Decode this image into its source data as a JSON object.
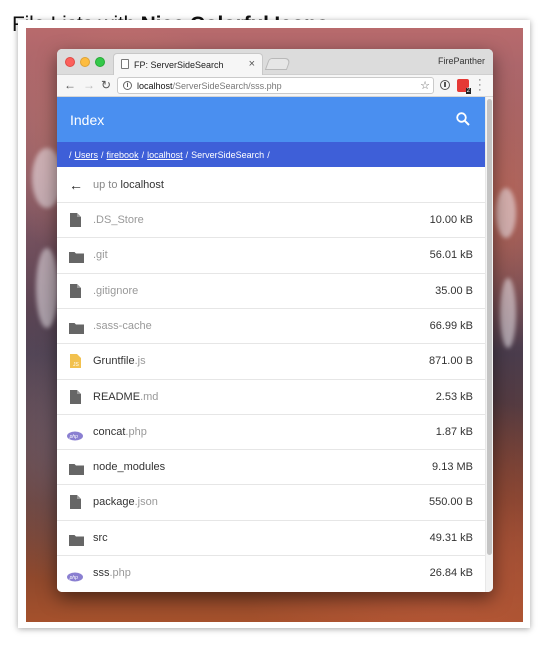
{
  "headline": {
    "part1": "File Lists with ",
    "part2": "Nice Colorful Icons"
  },
  "browser": {
    "tab_title": "FP: ServerSideSearch",
    "tab_close": "×",
    "profile": "FirePanther",
    "url_host": "localhost",
    "url_path": "/ServerSideSearch/sss.php",
    "extension_badge": "2"
  },
  "app": {
    "title": "Index"
  },
  "breadcrumb": {
    "items": [
      {
        "label": "Users",
        "link": true
      },
      {
        "label": "firebook",
        "link": true
      },
      {
        "label": "localhost",
        "link": true
      },
      {
        "label": "ServerSideSearch",
        "link": false
      }
    ]
  },
  "up": {
    "prefix": "up to ",
    "target": "localhost"
  },
  "files": [
    {
      "base": "",
      "ext": ".DS_Store",
      "size": "10.00 kB",
      "icon": "file-icon"
    },
    {
      "base": "",
      "ext": ".git",
      "size": "56.01 kB",
      "icon": "folder-icon"
    },
    {
      "base": "",
      "ext": ".gitignore",
      "size": "35.00 B",
      "icon": "file-icon"
    },
    {
      "base": "",
      "ext": ".sass-cache",
      "size": "66.99 kB",
      "icon": "folder-icon"
    },
    {
      "base": "Gruntfile",
      "ext": ".js",
      "size": "871.00 B",
      "icon": "js-icon"
    },
    {
      "base": "README",
      "ext": ".md",
      "size": "2.53 kB",
      "icon": "file-icon"
    },
    {
      "base": "concat",
      "ext": ".php",
      "size": "1.87 kB",
      "icon": "php-icon"
    },
    {
      "base": "node_modules",
      "ext": "",
      "size": "9.13 MB",
      "icon": "folder-icon"
    },
    {
      "base": "package",
      "ext": ".json",
      "size": "550.00 B",
      "icon": "file-icon"
    },
    {
      "base": "src",
      "ext": "",
      "size": "49.31 kB",
      "icon": "folder-icon"
    },
    {
      "base": "sss",
      "ext": ".php",
      "size": "26.84 kB",
      "icon": "php-icon"
    }
  ],
  "icon_labels": {
    "js": "JS",
    "php": "php"
  },
  "colors": {
    "appbar": "#4a8ff0",
    "breadcrumb": "#3e5fd8",
    "js": "#f2c14e",
    "php": "#8a7fd1",
    "icon_gray": "#666666"
  }
}
